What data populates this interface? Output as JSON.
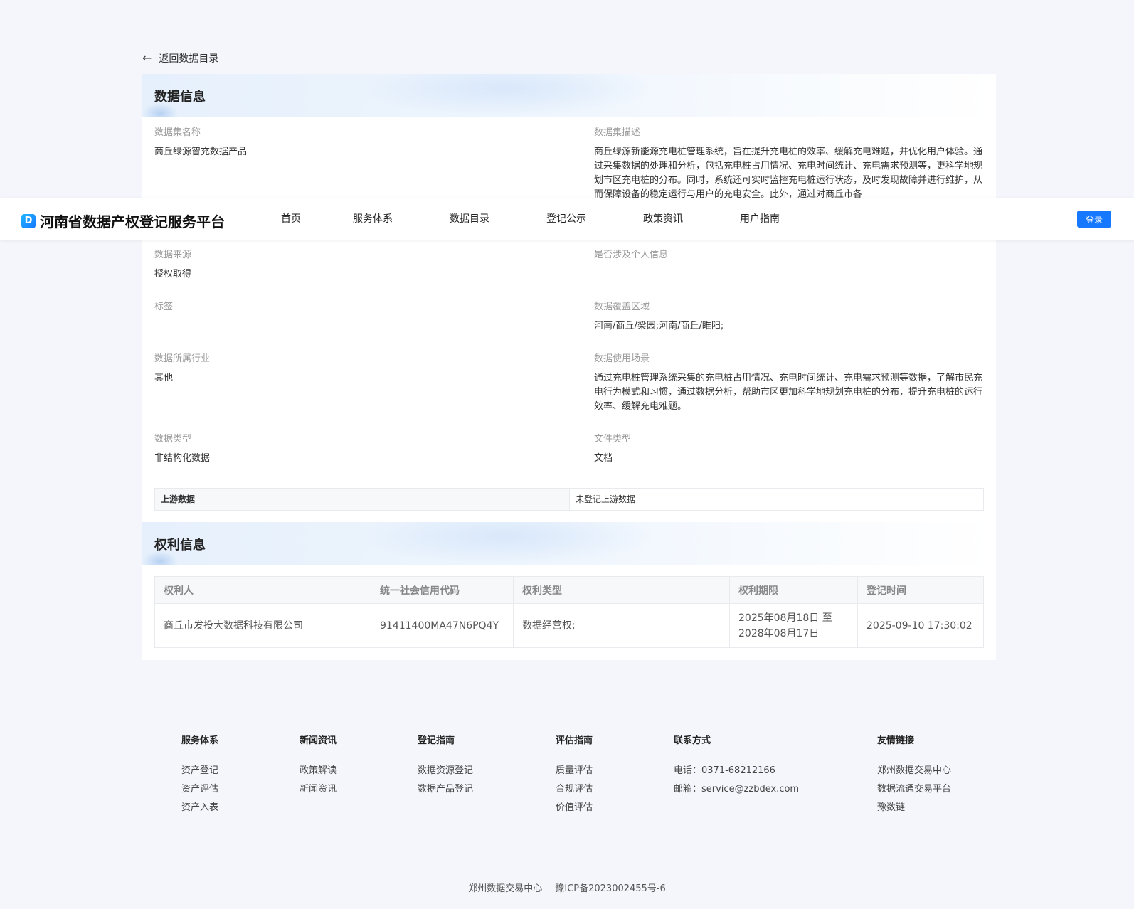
{
  "back_link": {
    "label": "返回数据目录"
  },
  "data_section": {
    "title": "数据信息",
    "fields": {
      "name": {
        "label": "数据集名称",
        "value": "商丘绿源智充数据产品"
      },
      "description": {
        "label": "数据集描述",
        "value": "商丘绿源新能源充电桩管理系统，旨在提升充电桩的效率、缓解充电难题，并优化用户体验。通过采集数据的处理和分析，包括充电桩占用情况、充电时间统计、充电需求预测等，更科学地规划市区充电桩的分布。同时，系统还可实时监控充电桩运行状态，及时发现故障并进行维护，从而保障设备的稳定运行与用户的充电安全。此外，通过对商丘市各"
      },
      "source": {
        "label": "数据来源",
        "value": "授权取得"
      },
      "personal_info": {
        "label": "是否涉及个人信息",
        "value": ""
      },
      "tags": {
        "label": "标签",
        "value": ""
      },
      "coverage": {
        "label": "数据覆盖区域",
        "value": "河南/商丘/梁园;河南/商丘/睢阳;"
      },
      "industry": {
        "label": "数据所属行业",
        "value": "其他"
      },
      "scenario": {
        "label": "数据使用场景",
        "value": "通过充电桩管理系统采集的充电桩占用情况、充电时间统计、充电需求预测等数据，了解市民充电行为模式和习惯，通过数据分析，帮助市区更加科学地规划充电桩的分布，提升充电桩的运行效率、缓解充电难题。"
      },
      "data_type": {
        "label": "数据类型",
        "value": "非结构化数据"
      },
      "file_type": {
        "label": "文件类型",
        "value": "文档"
      }
    },
    "upstream": {
      "label": "上游数据",
      "value": "未登记上游数据"
    }
  },
  "rights_section": {
    "title": "权利信息",
    "headers": [
      "权利人",
      "统一社会信用代码",
      "权利类型",
      "权利期限",
      "登记时间"
    ],
    "rows": [
      {
        "holder": "商丘市发投大数据科技有限公司",
        "credit_code": "91411400MA47N6PQ4Y",
        "right_type": "数据经营权;",
        "term_start": "2025年08月18日 至",
        "term_end": "2028年08月17日",
        "reg_time": "2025-09-10 17:30:02"
      }
    ]
  },
  "navbar": {
    "logo_text": "河南省数据产权登记服务平台",
    "items": [
      "首页",
      "服务体系",
      "数据目录",
      "登记公示",
      "政策资讯",
      "用户指南"
    ],
    "login_label": "登录"
  },
  "footer": {
    "columns": [
      {
        "title": "服务体系",
        "links": [
          "资产登记",
          "资产评估",
          "资产入表"
        ]
      },
      {
        "title": "新闻资讯",
        "links": [
          "政策解读",
          "新闻资讯"
        ]
      },
      {
        "title": "登记指南",
        "links": [
          "数据资源登记",
          "数据产品登记"
        ]
      },
      {
        "title": "评估指南",
        "links": [
          "质量评估",
          "合规评估",
          "价值评估"
        ]
      },
      {
        "title": "联系方式",
        "links": [
          "电话：0371-68212166",
          "邮箱：service@zzbdex.com"
        ]
      },
      {
        "title": "友情链接",
        "links": [
          "郑州数据交易中心",
          "数据流通交易平台",
          "豫数链"
        ]
      }
    ],
    "copyright": {
      "org": "郑州数据交易中心",
      "icp": "豫ICP备2023002455号-6"
    }
  },
  "colors": {
    "accent": "#1677ff",
    "background": "#f4f6fb"
  }
}
